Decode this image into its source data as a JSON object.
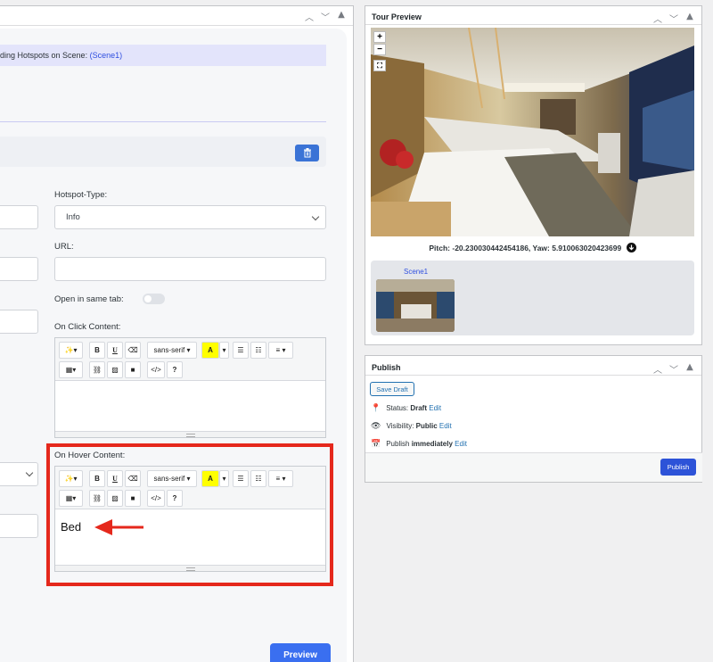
{
  "left_box": {
    "notice_prefix": "ding Hotspots on Scene: ",
    "notice_scene": "(Scene1)",
    "hotspot_type_label": "Hotspot-Type:",
    "hotspot_type_value": "Info",
    "url_label": "URL:",
    "url_value": "",
    "open_same_tab_label": "Open in same tab:",
    "on_click_label": "On Click Content:",
    "on_hover_label": "On Hover Content:",
    "on_hover_text": "Bed",
    "preview_label": "Preview"
  },
  "editor_toolbar": {
    "font_family": "sans-serif",
    "bold": "B",
    "underline": "U",
    "help": "?"
  },
  "tour_preview": {
    "title": "Tour Preview",
    "zoom_in": "+",
    "zoom_out": "−",
    "pitch_yaw": "Pitch: -20.230030442454186, Yaw: 5.910063020423699",
    "scene_label": "Scene1"
  },
  "publish": {
    "title": "Publish",
    "save_draft": "Save Draft",
    "status_label": "Status: ",
    "status_value": "Draft",
    "visibility_label": "Visibility: ",
    "visibility_value": "Public",
    "publish_label": "Publish ",
    "publish_value": "immediately",
    "edit_link": "Edit",
    "publish_button": "Publish"
  },
  "colors": {
    "accent": "#3a6ff0",
    "highlight_border": "#e5281c",
    "wp_link": "#2271b1"
  }
}
